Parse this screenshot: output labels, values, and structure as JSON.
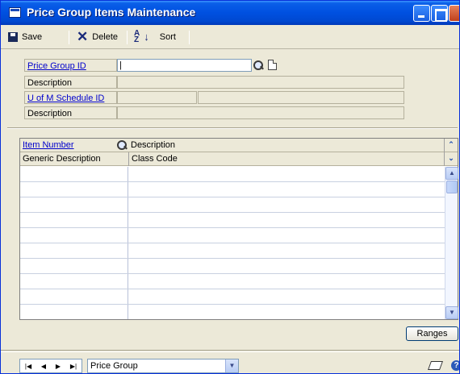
{
  "window": {
    "title": "Price Group Items Maintenance"
  },
  "toolbar": {
    "save_label": "Save",
    "delete_label": "Delete",
    "sort_label": "Sort"
  },
  "form": {
    "price_group_id_label": "Price Group ID",
    "price_group_id_value": "|",
    "description_label": "Description",
    "uofm_schedule_label": "U of M Schedule ID",
    "description2_label": "Description"
  },
  "grid": {
    "headers": {
      "item_number": "Item Number",
      "description": "Description",
      "generic_description": "Generic Description",
      "class_code": "Class Code"
    },
    "rows": [
      [
        "",
        ""
      ],
      [
        "",
        ""
      ],
      [
        "",
        ""
      ],
      [
        "",
        ""
      ],
      [
        "",
        ""
      ],
      [
        "",
        ""
      ],
      [
        "",
        ""
      ],
      [
        "",
        ""
      ],
      [
        "",
        ""
      ],
      [
        "",
        ""
      ]
    ]
  },
  "buttons": {
    "ranges_label": "Ranges"
  },
  "statusbar": {
    "browse_by": "Price Group",
    "nav_first": "|◀",
    "nav_prev": "◀",
    "nav_next": "▶",
    "nav_last": "▶|"
  },
  "colors": {
    "title_blue": "#0050e0",
    "link_blue": "#0000cc",
    "window_bg": "#ece9d8"
  }
}
